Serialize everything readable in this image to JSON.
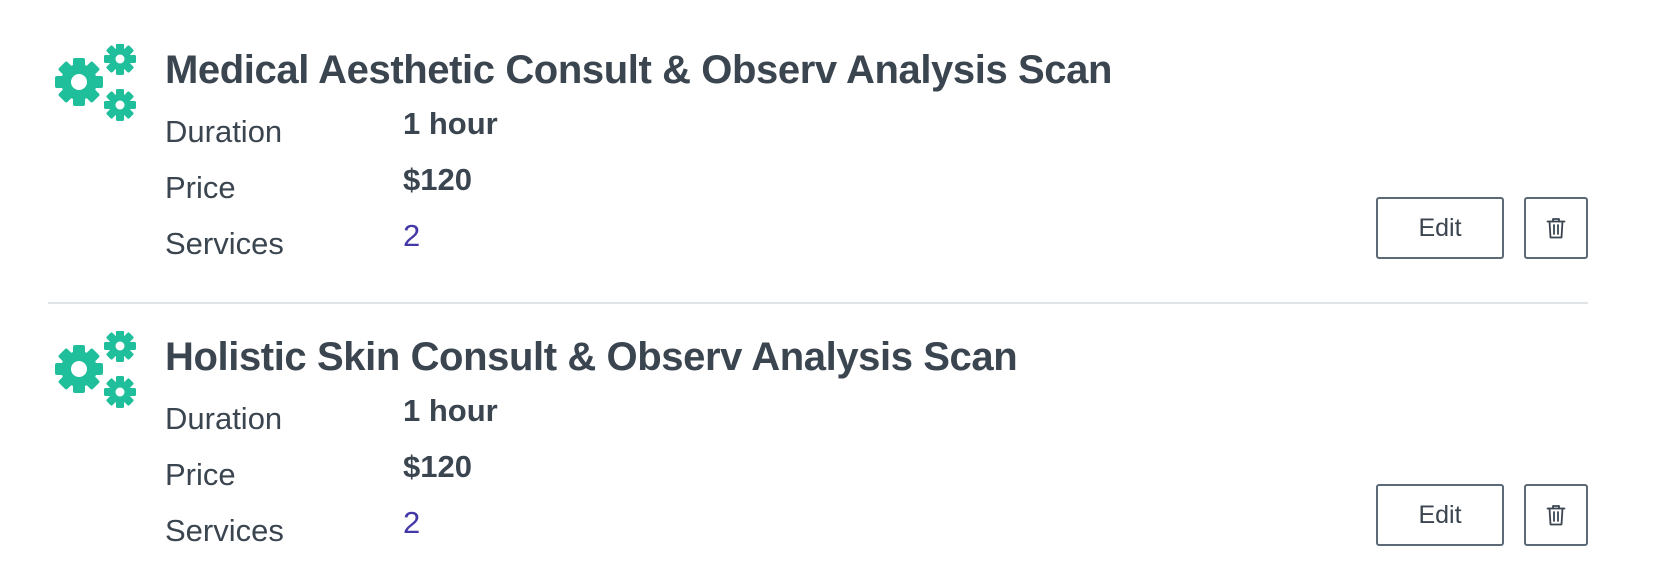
{
  "theme": {
    "icon_color": "#20bf9c",
    "text_color": "#3a4550",
    "link_color": "#4338a8"
  },
  "labels": {
    "duration": "Duration",
    "price": "Price",
    "services": "Services",
    "edit_button": "Edit"
  },
  "packages": [
    {
      "icon": "gears-icon",
      "title": "Medical Aesthetic Consult & Observ Analysis Scan",
      "duration": "1 hour",
      "price": "$120",
      "services": "2"
    },
    {
      "icon": "gears-icon",
      "title": "Holistic Skin Consult & Observ Analysis Scan",
      "duration": "1 hour",
      "price": "$120",
      "services": "2"
    }
  ]
}
